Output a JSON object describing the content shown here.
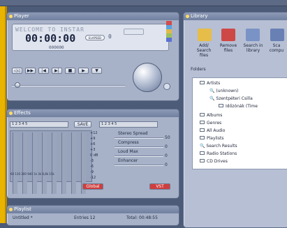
{
  "player": {
    "title": "Player",
    "welcome": "WELCOME TO INSTAR",
    "time": "00:00:00",
    "subtime": "000000",
    "status": "ELAPSED",
    "zero": "0"
  },
  "effects": {
    "title": "Effects",
    "save": "SAVE",
    "global": "Global",
    "vst": "VST",
    "tabs": [
      "1",
      "2",
      "3",
      "4",
      "5"
    ],
    "values": [
      "+12",
      "+9",
      "+6",
      "+3",
      "0 dB",
      "-3",
      "-6",
      "-9",
      "-12"
    ],
    "freqs": [
      "60",
      "130",
      "300",
      "940",
      "1k",
      "3k",
      "6,8k",
      "15k"
    ],
    "knobs": [
      "Stereo Spread",
      "Compress",
      "Loud Max",
      "Enhancer"
    ],
    "knob_values": [
      "50",
      "0",
      "0",
      "0"
    ]
  },
  "playlist": {
    "title": "Playlist",
    "name": "Untitled *",
    "entries": "Entries 12",
    "total": "Total: 00:48:55"
  },
  "library": {
    "title": "Library",
    "tools": [
      "Add/ Search files",
      "Remove files",
      "Search in library",
      "Sca compu"
    ],
    "folders": "Folders",
    "items": [
      "Artists",
      "(unknown)",
      "Szentpéteri Csilla",
      "Időzónák (Time",
      "Albums",
      "Genres",
      "All Audio",
      "Playlists",
      "Search Results",
      "Radio Stations",
      "CD Drives"
    ]
  }
}
